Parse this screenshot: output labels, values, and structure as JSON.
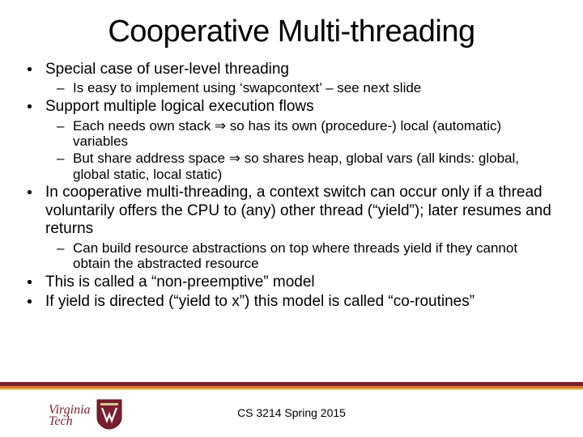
{
  "title": "Cooperative Multi-threading",
  "bullets": [
    {
      "text": "Special case of user-level threading",
      "sub": [
        {
          "text": "Is easy to implement using ‘swapcontext’ – see next slide"
        }
      ]
    },
    {
      "text": "Support multiple logical execution flows",
      "sub": [
        {
          "text": "Each needs own stack ⇒ so has its own (procedure-) local (automatic) variables"
        },
        {
          "text": "But share address space ⇒ so shares heap, global vars (all kinds: global, global static, local static)"
        }
      ]
    },
    {
      "text": "In cooperative multi-threading, a context switch can occur only if a thread voluntarily offers the CPU to (any) other thread (“yield”); later resumes and returns",
      "sub": [
        {
          "text": "Can build resource abstractions on top where threads yield if they cannot obtain the abstracted resource"
        }
      ]
    },
    {
      "text": "This is called a “non-preemptive” model",
      "sub": []
    },
    {
      "text": "If yield is directed (“yield to x”) this model is called “co-routines”",
      "sub": []
    }
  ],
  "logo": {
    "line1": "Virginia",
    "line2": "Tech"
  },
  "footer": "CS 3214 Spring 2015"
}
